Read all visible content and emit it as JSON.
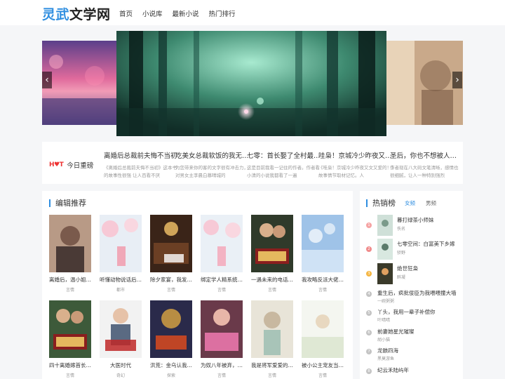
{
  "header": {
    "logo_accent": "灵武",
    "logo_main": "文学网",
    "nav": [
      "首页",
      "小说库",
      "最新小说",
      "热门排行"
    ]
  },
  "carousel": {
    "prev_icon": "chevron-left-icon",
    "next_icon": "chevron-right-icon"
  },
  "hot": {
    "badge": "H♥T",
    "label": "今日重磅",
    "items": [
      {
        "title": "离婚后总裁前夫悔不当初",
        "desc": "《离婚后总裁前夫悔不当初》这本书的故事性很强 让人百看不厌"
      },
      {
        "title": "吃美女总裁软饭的我无敌了",
        "desc": "为您带来你的客的文字很有冲击力，对男女主李晨白慕晴城的"
      },
      {
        "title": "七零：首长娶了全村最野的",
        "desc": "这是目前我看一记住的作者。作者看小清的小说我都看了一遍"
      },
      {
        "title": "哇枭！京城冷少昨夜又跪了",
        "desc": "《哇枭！京城冷少昨夜又文又爱的！》故事情节取材记忆。人"
      },
      {
        "title": "圣后，你也不想被人知道吧",
        "desc": "作者现在八大码文笔清晰，感情也很细腻，让人一种特别强烈"
      }
    ]
  },
  "recommend": {
    "title": "编辑推荐",
    "books": [
      {
        "name": "离婚后，温小姐成了顶流",
        "cat": "言情"
      },
      {
        "name": "听懂动物说话后我成了",
        "cat": "都市"
      },
      {
        "name": "除夕家宴，我发现老公出",
        "cat": "言情"
      },
      {
        "name": "绑定学人精系统后我杀",
        "cat": "言情"
      },
      {
        "name": "一遇未来的电话我杀疯了",
        "cat": "言情"
      },
      {
        "name": "我攻略反派大佬千百次",
        "cat": "言情"
      },
      {
        "name": "四十离婚嫁首长我胜利",
        "cat": "言情"
      },
      {
        "name": "大医时代",
        "cat": "奇幻"
      },
      {
        "name": "洪荒：金乌认我当大哥",
        "cat": "探索"
      },
      {
        "name": "为奴八年被弃，我杀疯了",
        "cat": "言情"
      },
      {
        "name": "我是将军爱爱的小娇娘",
        "cat": "言情"
      },
      {
        "name": "被小公主宠友当一生",
        "cat": "言情"
      }
    ]
  },
  "rank": {
    "title": "热销榜",
    "tabs": [
      "女频",
      "男频"
    ],
    "items": [
      {
        "num": "1",
        "title": "暮打绿茶小师妹",
        "author": "佚名"
      },
      {
        "num": "2",
        "title": "七零空间：白富美下乡嫁",
        "author": "骄野"
      },
      {
        "num": "3",
        "title": "绝世狂枭",
        "author": "醉凝"
      },
      {
        "num": "4",
        "title": "重生后，疯批佞臣为我喂喂撞大墙",
        "author": "一碗粥粥"
      },
      {
        "num": "5",
        "title": "丫头，我用一辈子补偿你",
        "author": "叶晴晴"
      },
      {
        "num": "6",
        "title": "前妻她星光璀璨",
        "author": "胡小猫"
      },
      {
        "num": "7",
        "title": "龙骸四海",
        "author": "黑莫游鱼"
      },
      {
        "num": "8",
        "title": "纪云禾陆屿年",
        "author": ""
      }
    ]
  }
}
